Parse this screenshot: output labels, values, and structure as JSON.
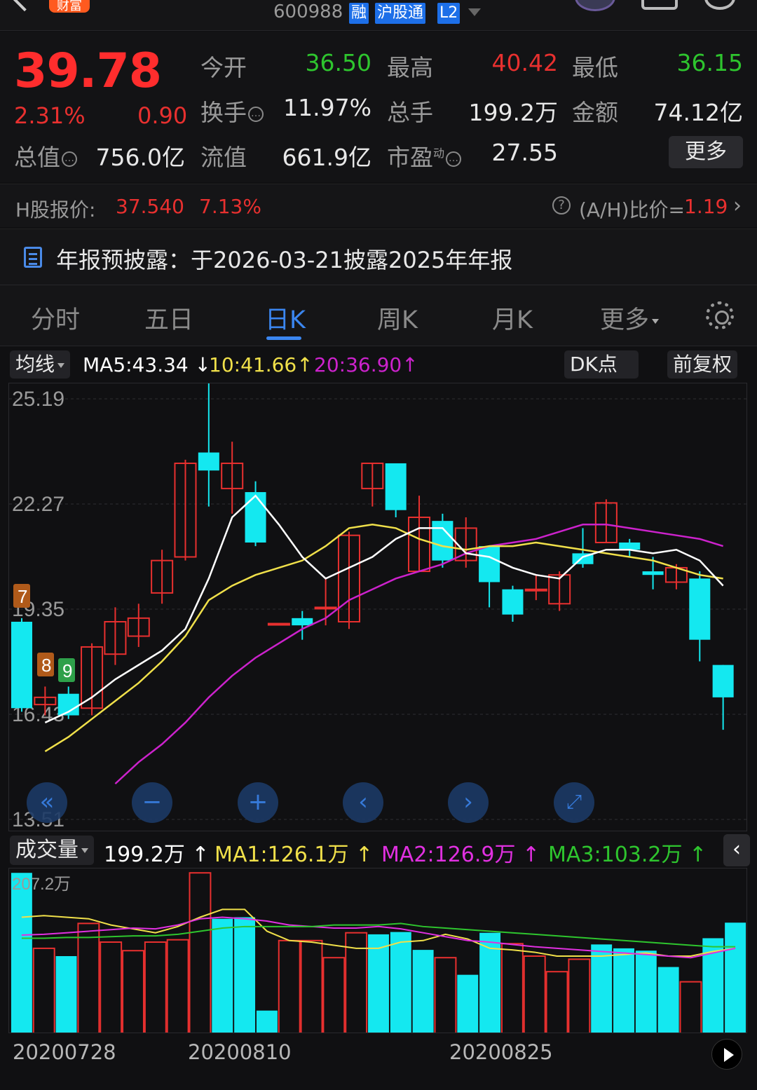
{
  "header": {
    "logo_text": "财富",
    "code": "600988",
    "tags": [
      "融",
      "沪股通",
      "L2"
    ]
  },
  "quote": {
    "price": "39.78",
    "change_pct": "2.31%",
    "change": "0.90",
    "open_label": "今开",
    "open": "36.50",
    "high_label": "最高",
    "high": "40.42",
    "low_label": "最低",
    "low": "36.15",
    "turnover_label": "换手",
    "turnover": "11.97%",
    "volume_label": "总手",
    "volume": "199.2万",
    "amount_label": "金额",
    "amount": "74.12亿",
    "mktcap_label": "总值",
    "mktcap": "756.0亿",
    "float_label": "流值",
    "float": "661.9亿",
    "pe_label": "市盈",
    "pe_sup": "动",
    "pe": "27.55",
    "more_label": "更多"
  },
  "hshare": {
    "label": "H股报价:",
    "price": "37.540",
    "pct": "7.13%",
    "ratio_label": "(A/H)比价=",
    "ratio": "1.19"
  },
  "notice": {
    "text": "年报预披露：于2026-03-21披露2025年年报"
  },
  "tabs": [
    "分时",
    "五日",
    "日K",
    "周K",
    "月K",
    "更多"
  ],
  "ma": {
    "selector": "均线",
    "ma5": "MA5:43.34",
    "ma10": "10:41.66",
    "ma20": "20:36.90",
    "dk_label": "DK点",
    "adjust_label": "前复权"
  },
  "colors": {
    "up": "#e8302f",
    "down": "#14e8f0",
    "ma5": "#ffffff",
    "ma10": "#f0e04a",
    "ma20": "#cc22cc",
    "accent": "#3b86f0"
  },
  "chart_data": [
    {
      "type": "candlestick",
      "y_ticks": [
        "25.19",
        "22.27",
        "19.35",
        "16.43",
        "13.51"
      ],
      "ylim": [
        13.51,
        25.19
      ],
      "markers": [
        "7",
        "8",
        "9"
      ],
      "candles": [
        {
          "o": 19.0,
          "c": 16.6,
          "h": 19.1,
          "l": 16.5
        },
        {
          "o": 16.7,
          "c": 16.9,
          "h": 17.2,
          "l": 16.4
        },
        {
          "o": 17.0,
          "c": 16.4,
          "h": 17.2,
          "l": 16.3
        },
        {
          "o": 16.6,
          "c": 18.3,
          "h": 18.4,
          "l": 16.4
        },
        {
          "o": 18.1,
          "c": 19.0,
          "h": 19.4,
          "l": 17.8
        },
        {
          "o": 18.6,
          "c": 19.1,
          "h": 19.5,
          "l": 18.3
        },
        {
          "o": 19.8,
          "c": 20.7,
          "h": 21.0,
          "l": 19.5
        },
        {
          "o": 20.8,
          "c": 23.4,
          "h": 23.5,
          "l": 20.7
        },
        {
          "o": 23.7,
          "c": 23.2,
          "h": 25.8,
          "l": 22.2
        },
        {
          "o": 22.7,
          "c": 23.4,
          "h": 24.0,
          "l": 22.0
        },
        {
          "o": 22.6,
          "c": 21.2,
          "h": 22.9,
          "l": 21.1
        },
        {
          "o": 18.95,
          "c": 18.95,
          "h": 18.95,
          "l": 18.95
        },
        {
          "o": 19.1,
          "c": 18.9,
          "h": 19.3,
          "l": 18.5
        },
        {
          "o": 19.4,
          "c": 19.4,
          "h": 20.2,
          "l": 18.9
        },
        {
          "o": 19.0,
          "c": 21.4,
          "h": 21.5,
          "l": 18.8
        },
        {
          "o": 22.7,
          "c": 23.4,
          "h": 23.4,
          "l": 22.2
        },
        {
          "o": 23.4,
          "c": 22.1,
          "h": 23.4,
          "l": 21.9
        },
        {
          "o": 20.4,
          "c": 21.9,
          "h": 22.5,
          "l": 20.4
        },
        {
          "o": 21.8,
          "c": 20.7,
          "h": 22.0,
          "l": 20.5
        },
        {
          "o": 20.7,
          "c": 21.6,
          "h": 21.9,
          "l": 20.5
        },
        {
          "o": 21.1,
          "c": 20.1,
          "h": 21.1,
          "l": 19.4
        },
        {
          "o": 19.9,
          "c": 19.2,
          "h": 20.0,
          "l": 19.0
        },
        {
          "o": 19.9,
          "c": 19.9,
          "h": 20.3,
          "l": 19.6
        },
        {
          "o": 19.5,
          "c": 20.3,
          "h": 20.4,
          "l": 19.3
        },
        {
          "o": 20.9,
          "c": 20.6,
          "h": 21.6,
          "l": 20.5
        },
        {
          "o": 21.2,
          "c": 22.3,
          "h": 22.4,
          "l": 21.2
        },
        {
          "o": 21.2,
          "c": 21.0,
          "h": 21.3,
          "l": 20.8
        },
        {
          "o": 20.4,
          "c": 20.3,
          "h": 20.8,
          "l": 19.9
        },
        {
          "o": 20.1,
          "c": 20.5,
          "h": 20.6,
          "l": 19.9
        },
        {
          "o": 20.2,
          "c": 18.5,
          "h": 20.4,
          "l": 17.9
        },
        {
          "o": 17.8,
          "c": 16.9,
          "h": 17.8,
          "l": 16.0
        }
      ],
      "ma5": [
        16.2,
        16.5,
        16.9,
        17.4,
        17.8,
        18.2,
        18.8,
        20.2,
        21.9,
        22.5,
        21.7,
        20.8,
        20.2,
        20.5,
        20.8,
        21.3,
        21.6,
        21.6,
        20.9,
        20.8,
        20.5,
        20.3,
        20.2,
        20.8,
        21.0,
        21.0,
        20.9,
        21.0,
        20.7,
        20.0
      ],
      "ma10": [
        15.4,
        15.8,
        16.3,
        16.8,
        17.3,
        17.9,
        18.6,
        19.6,
        20.0,
        20.3,
        20.5,
        20.7,
        21.1,
        21.6,
        21.7,
        21.6,
        21.3,
        21.1,
        21.0,
        21.1,
        21.1,
        21.2,
        21.1,
        21.0,
        20.9,
        20.8,
        20.7,
        20.5,
        20.3,
        20.2
      ],
      "ma20": [
        14.5,
        15.1,
        15.6,
        16.2,
        16.9,
        17.5,
        18.0,
        18.4,
        18.8,
        19.1,
        19.6,
        19.9,
        20.2,
        20.4,
        20.6,
        20.9,
        21.1,
        21.2,
        21.3,
        21.5,
        21.7,
        21.7,
        21.6,
        21.5,
        21.4,
        21.3,
        21.1
      ]
    },
    {
      "type": "bar",
      "title": "成交量",
      "current": "199.2万",
      "ma1": "MA1:126.1万",
      "ma2": "MA2:126.9万",
      "ma3": "MA3:103.2万",
      "ymax_label": "207.2万",
      "ylim": [
        0,
        207.2
      ],
      "values": [
        207,
        110,
        100,
        142,
        118,
        107,
        118,
        121,
        207,
        148,
        150,
        30,
        120,
        120,
        98,
        130,
        128,
        131,
        108,
        98,
        76,
        130,
        116,
        100,
        80,
        96,
        115,
        110,
        107,
        86,
        67,
        123,
        143
      ]
    }
  ],
  "xaxis": {
    "dates": [
      "20200728",
      "20200810",
      "20200825"
    ]
  }
}
